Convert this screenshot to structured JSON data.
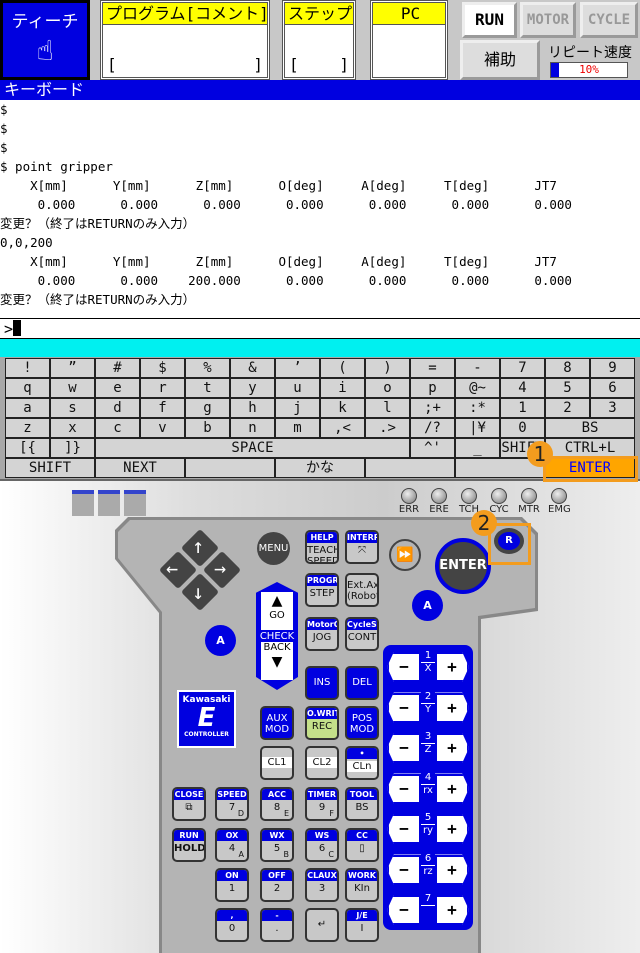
{
  "header": {
    "mode": "ティーチ",
    "mode_icon": "hand-pointer-icon",
    "program_label": "プログラム[コメント]",
    "program_value": [
      "[",
      "]"
    ],
    "step_label": "ステップ",
    "step_value": [
      "[",
      "]"
    ],
    "pc_label": "PC",
    "run": "RUN",
    "motor": "MOTOR",
    "cycle": "CYCLE",
    "aux": "補助",
    "repeat_speed_label": "リピート速度",
    "repeat_speed": "10%",
    "repeat_speed_pct": 10
  },
  "window_title": "キーボード",
  "console": {
    "lines": [
      "$",
      "$",
      "$",
      "$ point gripper",
      "    X[mm]      Y[mm]      Z[mm]      O[deg]     A[deg]     T[deg]      JT7",
      "     0.000      0.000      0.000      0.000      0.000      0.000      0.000",
      "変更？（終了はRETURNのみ入力）",
      "0,0,200",
      "    X[mm]      Y[mm]      Z[mm]      O[deg]     A[deg]     T[deg]      JT7",
      "     0.000      0.000    200.000      0.000      0.000      0.000      0.000",
      "変更？（終了はRETURNのみ入力）"
    ],
    "prompt": ">"
  },
  "keyboard": {
    "rows": [
      [
        "!",
        "”",
        "#",
        "$",
        "%",
        "&",
        "’",
        "(",
        ")",
        "=",
        "-",
        "7",
        "8",
        "9"
      ],
      [
        "q",
        "w",
        "e",
        "r",
        "t",
        "y",
        "u",
        "i",
        "o",
        "p",
        "@~",
        "4",
        "5",
        "6"
      ],
      [
        "a",
        "s",
        "d",
        "f",
        "g",
        "h",
        "j",
        "k",
        "l",
        ";+",
        ":*",
        "1",
        "2",
        "3"
      ],
      [
        "z",
        "x",
        "c",
        "v",
        "b",
        "n",
        "m",
        ",<",
        ".>",
        "/?",
        "|¥",
        "0",
        "BS"
      ],
      [
        "[{",
        "]}",
        "SPACE",
        "^'",
        "_",
        "SHIFT",
        "CTRL+L"
      ],
      [
        "SHIFT",
        "NEXT",
        "",
        "かな",
        "",
        "",
        "ENTER"
      ]
    ]
  },
  "indicators": [
    "ERR",
    "ERE",
    "TCH",
    "CYC",
    "MTR",
    "EMG"
  ],
  "pendant": {
    "menu": "MENU",
    "enter": "ENTER",
    "r": "R",
    "a": "A",
    "go": "GO",
    "check": "CHECK",
    "back": "BACK",
    "logo": {
      "brand": "Kawasaki",
      "letter": "E",
      "sub": "CONTROLLER"
    },
    "keys": [
      {
        "h": "HELP",
        "m": "TEACH\nSPEED"
      },
      {
        "h": "INTERP",
        "m": "⤧"
      },
      {
        "h": "PROGRAM",
        "m": "STEP"
      },
      {
        "h": "",
        "m": "Ext.Axis\n(Robot)"
      },
      {
        "h": "MotorON",
        "m": "JOG"
      },
      {
        "h": "CycleStart",
        "m": "CONT"
      },
      {
        "h": "",
        "m": "INS"
      },
      {
        "h": "",
        "m": "DEL"
      },
      {
        "h": "",
        "m": "AUX\nMOD"
      },
      {
        "h": "O.WRITE",
        "m": "REC"
      },
      {
        "h": "",
        "m": "POS\nMOD"
      },
      {
        "h": "",
        "m": "CL1"
      },
      {
        "h": "",
        "m": "CL2"
      },
      {
        "h": "•",
        "m": "CLn"
      },
      {
        "h": "CLOSE",
        "m": "⧉"
      },
      {
        "h": "SPEED",
        "m": "7",
        "s": "D"
      },
      {
        "h": "ACC",
        "m": "8",
        "s": "E"
      },
      {
        "h": "TIMER",
        "m": "9",
        "s": "F"
      },
      {
        "h": "TOOL",
        "m": "BS"
      },
      {
        "h": "RUN",
        "m": "HOLD"
      },
      {
        "h": "OX",
        "m": "4",
        "s": "A"
      },
      {
        "h": "WX",
        "m": "5",
        "s": "B"
      },
      {
        "h": "WS",
        "m": "6",
        "s": "C"
      },
      {
        "h": "CC",
        "m": "▯"
      },
      {
        "h": "ON",
        "m": "1"
      },
      {
        "h": "OFF",
        "m": "2"
      },
      {
        "h": "CLAUX",
        "m": "3"
      },
      {
        "h": "WORK",
        "m": "KIn"
      },
      {
        "h": ",",
        "m": "0"
      },
      {
        "h": "-",
        "m": "."
      },
      {
        "h": "",
        "m": "↵"
      },
      {
        "h": "J/E",
        "m": "I"
      }
    ],
    "jog": [
      {
        "n": "1",
        "a": "X"
      },
      {
        "n": "2",
        "a": "Y"
      },
      {
        "n": "3",
        "a": "Z"
      },
      {
        "n": "4",
        "a": "rx"
      },
      {
        "n": "5",
        "a": "ry"
      },
      {
        "n": "6",
        "a": "rz"
      },
      {
        "n": "7",
        "a": ""
      }
    ],
    "minus": "−",
    "plus": "+"
  },
  "annotations": [
    "1",
    "2"
  ],
  "colors": {
    "accent_blue": "#0000e0",
    "header_yellow": "#ffff00",
    "highlight_orange": "#f39c1e",
    "rec_green": "#c4e08a"
  }
}
